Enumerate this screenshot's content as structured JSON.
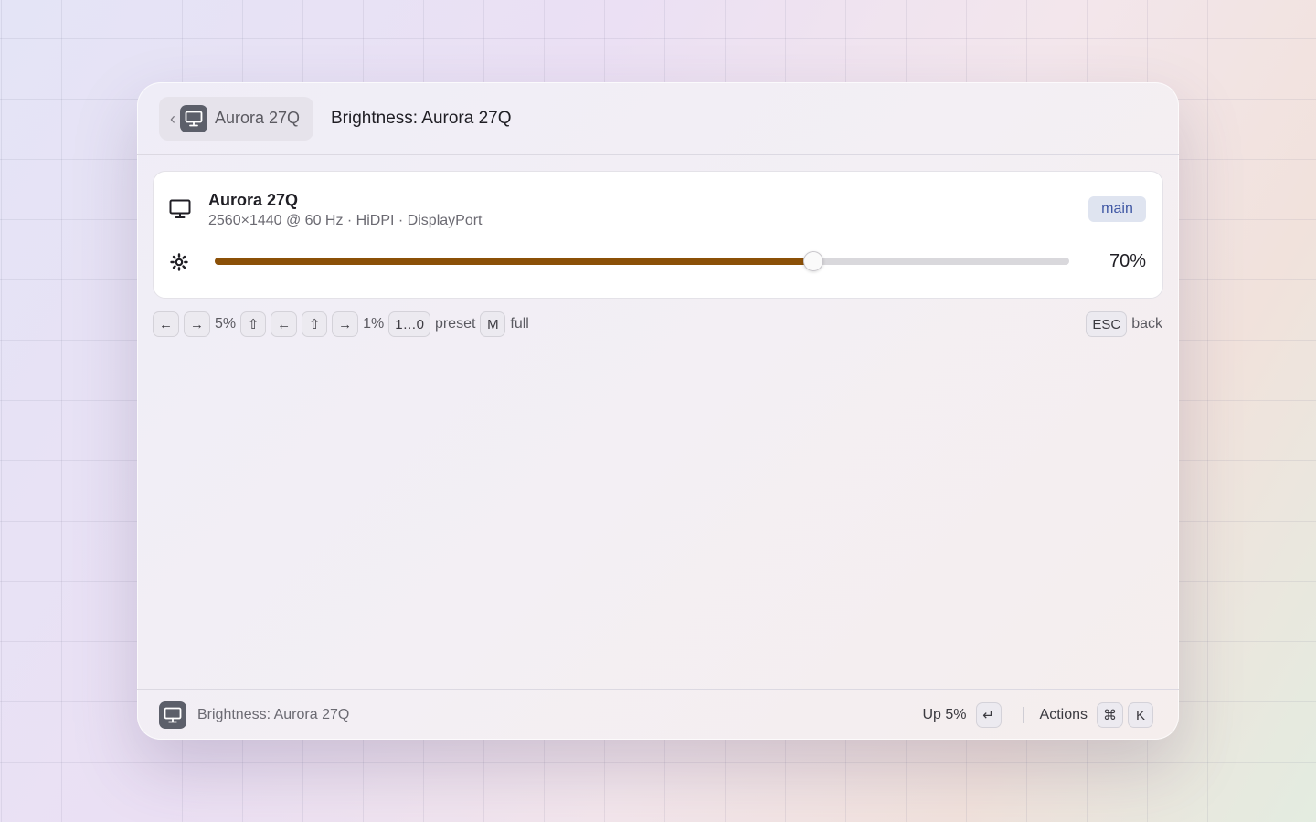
{
  "header": {
    "back_chevron": "‹",
    "back_label": "Aurora 27Q",
    "title": "Brightness: Aurora 27Q"
  },
  "display": {
    "name": "Aurora 27Q",
    "spec": "2560×1440 @ 60 Hz · HiDPI · DisplayPort",
    "tag": "main",
    "brightness_percent": 70,
    "brightness_label": "70%",
    "accent_color": "#8b5007"
  },
  "hints": {
    "left_arrow": "←",
    "right_arrow": "→",
    "step_large": "5%",
    "shift": "⇧",
    "step_small": "1%",
    "preset_key": "1…0",
    "preset_label": "preset",
    "full_key": "M",
    "full_label": "full",
    "esc_key": "ESC",
    "esc_label": "back"
  },
  "footer": {
    "title": "Brightness: Aurora 27Q",
    "primary_action": "Up 5%",
    "enter_key": "↵",
    "actions_label": "Actions",
    "cmd_key": "⌘",
    "k_key": "K"
  },
  "icons": {
    "back": "chevron-left-icon",
    "display": "monitor-icon",
    "brightness": "sun-icon"
  }
}
